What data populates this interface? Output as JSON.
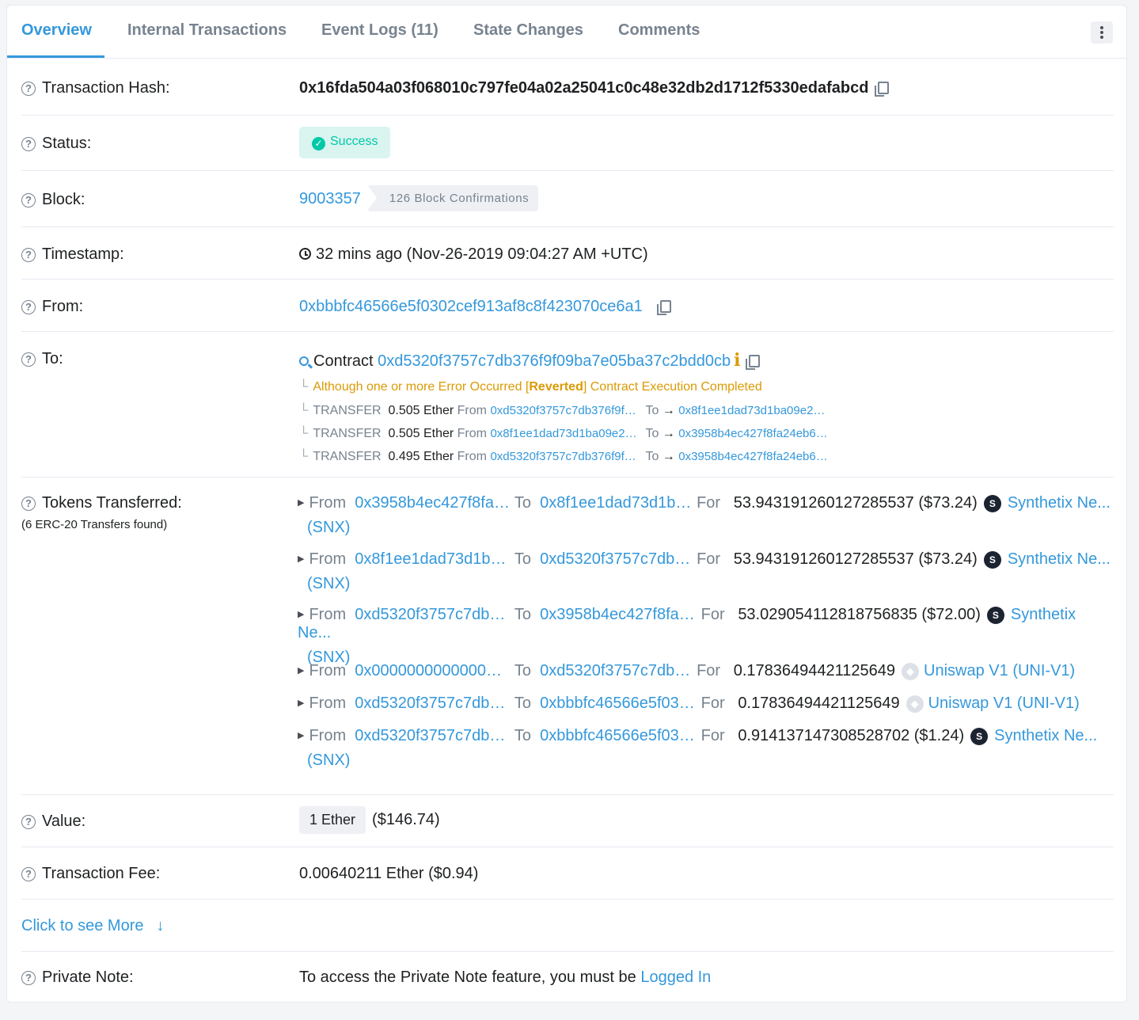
{
  "tabs": [
    {
      "label": "Overview",
      "active": true
    },
    {
      "label": "Internal Transactions"
    },
    {
      "label": "Event Logs (11)"
    },
    {
      "label": "State Changes"
    },
    {
      "label": "Comments"
    }
  ],
  "fields": {
    "tx_hash": {
      "label": "Transaction Hash:",
      "value": "0x16fda504a03f068010c797fe04a02a25041c0c48e32db2d1712f5330edafabcd"
    },
    "status": {
      "label": "Status:",
      "value": "Success"
    },
    "block": {
      "label": "Block:",
      "value": "9003357",
      "confirmations": "126 Block Confirmations"
    },
    "timestamp": {
      "label": "Timestamp:",
      "value": "32 mins ago (Nov-26-2019 09:04:27 AM +UTC)"
    },
    "from": {
      "label": "From:",
      "value": "0xbbbfc46566e5f0302cef913af8c8f423070ce6a1"
    },
    "to": {
      "label": "To:",
      "contract_prefix": "Contract",
      "contract": "0xd5320f3757c7db376f9f09ba7e05ba37c2bdd0cb",
      "warn_prefix": "Although one or more Error Occurred [",
      "warn_bold": "Reverted",
      "warn_suffix": "] Contract Execution Completed",
      "transfers": [
        {
          "type": "TRANSFER",
          "amount": "0.505 Ether",
          "from_label": "From",
          "from": "0xd5320f3757c7db376f9f…",
          "to_label": "To",
          "to": "0x8f1ee1dad73d1ba09e2…"
        },
        {
          "type": "TRANSFER",
          "amount": "0.505 Ether",
          "from_label": "From",
          "from": "0x8f1ee1dad73d1ba09e2…",
          "to_label": "To",
          "to": "0x3958b4ec427f8fa24eb6…"
        },
        {
          "type": "TRANSFER",
          "amount": "0.495 Ether",
          "from_label": "From",
          "from": "0xd5320f3757c7db376f9f…",
          "to_label": "To",
          "to": "0x3958b4ec427f8fa24eb6…"
        }
      ]
    },
    "tokens": {
      "label": "Tokens Transferred:",
      "sublabel": "(6 ERC-20 Transfers found)",
      "from_label": "From",
      "to_label": "To",
      "for_label": "For",
      "items": [
        {
          "from": "0x3958b4ec427f8fa…",
          "to": "0x8f1ee1dad73d1ba…",
          "amount": "53.943191260127285537 ($73.24)",
          "icon": "S",
          "token": "Synthetix Ne...",
          "symbol": "(SNX)"
        },
        {
          "from": "0x8f1ee1dad73d1ba…",
          "to": "0xd5320f3757c7db3…",
          "amount": "53.943191260127285537 ($73.24)",
          "icon": "S",
          "token": "Synthetix Ne...",
          "symbol": "(SNX)"
        },
        {
          "from": "0xd5320f3757c7db3…",
          "to": "0x3958b4ec427f8fa…",
          "amount": "53.029054112818756835 ($72.00)",
          "icon": "S",
          "token": "Synthetix Ne...",
          "symbol": "(SNX)"
        },
        {
          "from": "0x00000000000000…",
          "to": "0xd5320f3757c7db3…",
          "amount": "0.17836494421125649",
          "icon": "◆",
          "token": "Uniswap V1 (UNI-V1)",
          "symbol": ""
        },
        {
          "from": "0xd5320f3757c7db3…",
          "to": "0xbbbfc46566e5f03…",
          "amount": "0.17836494421125649",
          "icon": "◆",
          "token": "Uniswap V1 (UNI-V1)",
          "symbol": ""
        },
        {
          "from": "0xd5320f3757c7db3…",
          "to": "0xbbbfc46566e5f03…",
          "amount": "0.914137147308528702 ($1.24)",
          "icon": "S",
          "token": "Synthetix Ne...",
          "symbol": "(SNX)"
        }
      ]
    },
    "value": {
      "label": "Value:",
      "ether": "1 Ether",
      "usd": "($146.74)"
    },
    "fee": {
      "label": "Transaction Fee:",
      "value": "0.00640211 Ether ($0.94)"
    },
    "more": {
      "label": "Click to see More",
      "arrow": "↓"
    },
    "note": {
      "label": "Private Note:",
      "text": "To access the Private Note feature, you must be ",
      "link": "Logged In"
    }
  },
  "colors": {
    "link": "#3498db",
    "success": "#00c9a7",
    "warning": "#db9a04",
    "muted": "#77838f"
  }
}
